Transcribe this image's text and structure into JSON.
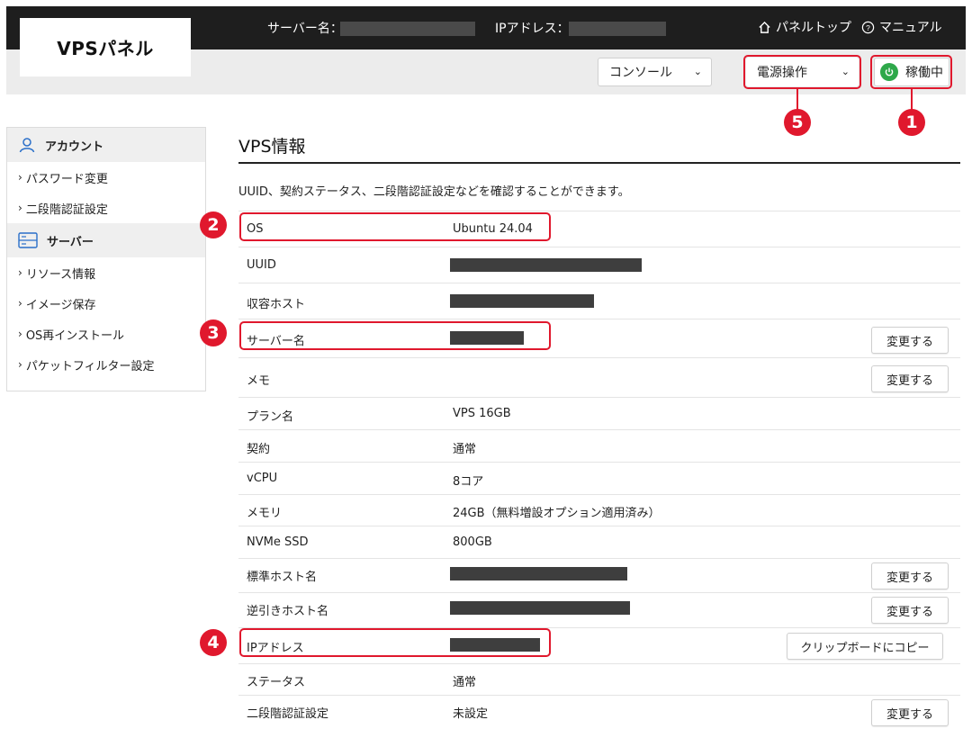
{
  "header": {
    "logo": "VPSパネル",
    "server_name_label": "サーバー名：",
    "ip_label": "IPアドレス：",
    "panel_top": "パネルトップ",
    "manual": "マニュアル"
  },
  "toolbar": {
    "console_select": "コンソール",
    "power_select": "電源操作",
    "status": "稼働中"
  },
  "markers": [
    "1",
    "2",
    "3",
    "4",
    "5"
  ],
  "sidebar": {
    "account_header": "アカウント",
    "account_items": [
      "パスワード変更",
      "二段階認証設定"
    ],
    "server_header": "サーバー",
    "server_items": [
      "リソース情報",
      "イメージ保存",
      "OS再インストール",
      "パケットフィルター設定"
    ]
  },
  "main": {
    "title": "VPS情報",
    "description": "UUID、契約ステータス、二段階認証設定などを確認することができます。",
    "rows": [
      {
        "label": "OS",
        "value": "Ubuntu 24.04"
      },
      {
        "label": "UUID",
        "value": ""
      },
      {
        "label": "収容ホスト",
        "value": ""
      },
      {
        "label": "サーバー名",
        "value": "",
        "button": "変更する"
      },
      {
        "label": "メモ",
        "value": "",
        "button": "変更する"
      },
      {
        "label": "プラン名",
        "value": "VPS 16GB"
      },
      {
        "label": "契約",
        "value": "通常"
      },
      {
        "label": "vCPU",
        "value": "8コア"
      },
      {
        "label": "メモリ",
        "value": "24GB（無料増設オプション適用済み）"
      },
      {
        "label": "NVMe SSD",
        "value": "800GB"
      },
      {
        "label": "標準ホスト名",
        "value": "",
        "button": "変更する"
      },
      {
        "label": "逆引きホスト名",
        "value": "",
        "button": "変更する"
      },
      {
        "label": "IPアドレス",
        "value": "",
        "button": "クリップボードにコピー"
      },
      {
        "label": "ステータス",
        "value": "通常"
      },
      {
        "label": "二段階認証設定",
        "value": "未設定",
        "button": "変更する"
      }
    ]
  },
  "colors": {
    "accent_red": "#e0182d",
    "status_green": "#2ea84a",
    "header_bg": "#1e1e1e"
  },
  "icons": [
    "home-icon",
    "help-icon",
    "chevron-down-icon",
    "power-icon",
    "user-icon",
    "server-icon",
    "chevron-right-icon"
  ]
}
